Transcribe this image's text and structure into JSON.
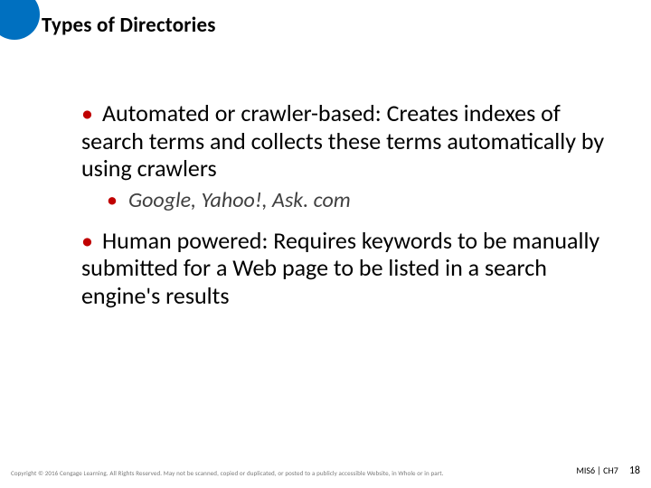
{
  "title": "Types of Directories",
  "bullets": {
    "item1": "Automated or crawler-based: Creates indexes of search terms and collects these terms automatically by using crawlers",
    "sub1": "Google, Yahoo!, Ask. com",
    "item2": "Human powered: Requires keywords to be manually submitted for a Web page to be listed in a search engine's results"
  },
  "footer": {
    "copyright": "Copyright © 2016 Cengage Learning. All Rights Reserved. May not be scanned, copied or duplicated, or posted to a publicly accessible Website, in Whole or in part.",
    "chapter": "MIS6 | CH7",
    "page": "18"
  },
  "glyph": {
    "dot": "•"
  }
}
